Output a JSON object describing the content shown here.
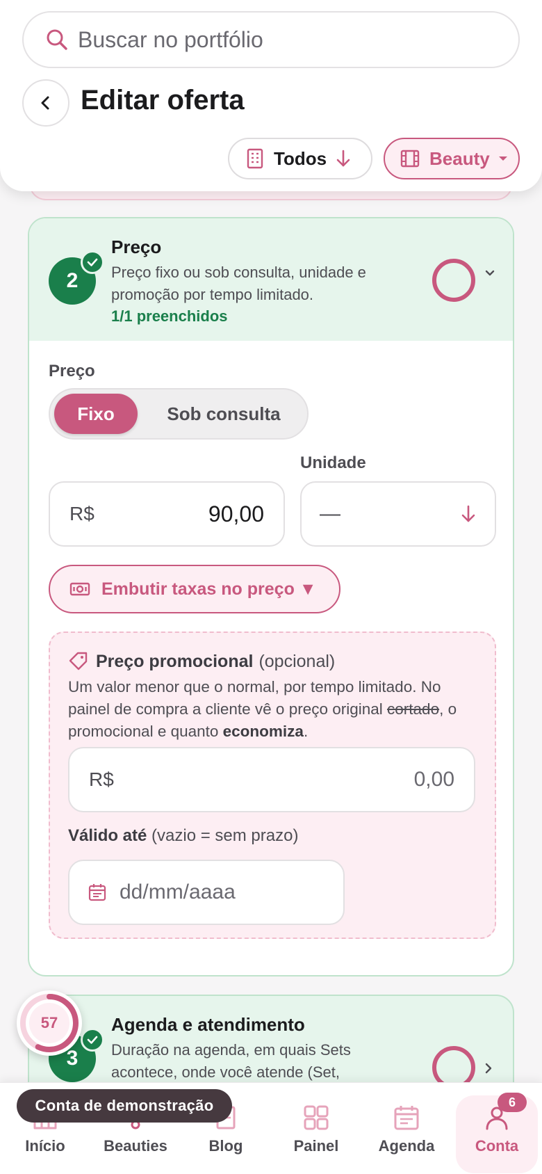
{
  "search": {
    "placeholder": "Buscar no portfólio"
  },
  "header": {
    "title": "Editar oferta"
  },
  "filters": [
    {
      "label": "Todos",
      "icon": "building-icon"
    },
    {
      "label": "Beauty",
      "icon": "film-icon"
    }
  ],
  "price_section": {
    "step": "2",
    "title": "Preço",
    "description": "Preço fixo ou sob consulta, unidade e promoção por tempo limitado.",
    "filled": "1/1 preenchidos",
    "price_label": "Preço",
    "toggle": {
      "fixed": "Fixo",
      "on_request": "Sob consulta",
      "selected": "Fixo"
    },
    "unit_label": "Unidade",
    "currency": "R$",
    "price_value": "90,00",
    "unit_value": "—",
    "fee_button": "Embutir taxas no preço ▼",
    "promo": {
      "title": "Preço promocional",
      "optional": "(opcional)",
      "desc_1": "Um valor menor que o normal, por tempo limitado. No painel de compra a cliente vê o preço original ",
      "desc_strike": "cortado",
      "desc_2": ", o promocional e quanto ",
      "desc_bold": "economiza",
      "desc_3": ".",
      "currency": "R$",
      "placeholder": "0,00",
      "valid_label": "Válido até",
      "valid_hint": "(vazio = sem prazo)",
      "date_placeholder": "dd/mm/aaaa"
    }
  },
  "agenda_section": {
    "step": "3",
    "title": "Agenda e atendimento",
    "description": "Duração na agenda, em quais Sets acontece, onde você atende (Set,"
  },
  "progress": {
    "value": "57",
    "fraction": 0.57
  },
  "demo_badge": "Conta de demonstração",
  "nav": [
    {
      "label": "Início",
      "icon": "home-icon"
    },
    {
      "label": "Beauties",
      "icon": "beauties-icon"
    },
    {
      "label": "Blog",
      "icon": "blog-icon"
    },
    {
      "label": "Painel",
      "icon": "grid-icon"
    },
    {
      "label": "Agenda",
      "icon": "calendar-icon"
    },
    {
      "label": "Conta",
      "icon": "user-icon",
      "badge": "6",
      "active": true
    }
  ],
  "colors": {
    "accent": "#c8587e",
    "success": "#1a7f4b",
    "success_bg": "#e6f5ec",
    "accent_bg": "#fdeef3"
  }
}
